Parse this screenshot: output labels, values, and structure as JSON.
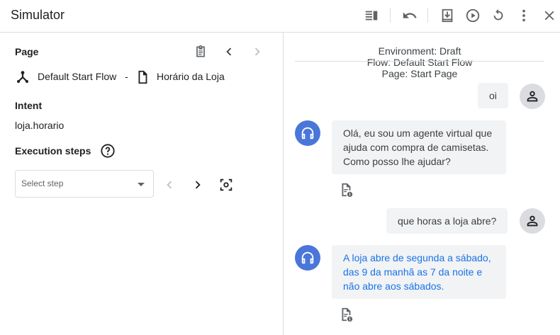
{
  "header": {
    "title": "Simulator",
    "icons": [
      "view-panel-icon",
      "undo-icon",
      "download-icon",
      "play-icon",
      "reset-icon",
      "more-vert-icon",
      "close-icon"
    ]
  },
  "left": {
    "page_label": "Page",
    "flow_name": "Default Start Flow",
    "separator": "-",
    "page_name": "Horário da Loja",
    "intent_label": "Intent",
    "intent_value": "loja.horario",
    "execution_label": "Execution steps",
    "select_placeholder": "Select step"
  },
  "right": {
    "environment": "Environment: Draft",
    "flow": "Flow: Default Start Flow",
    "page": "Page: Start Page",
    "messages": [
      {
        "role": "user",
        "text": "oi"
      },
      {
        "role": "agent",
        "text": "Olá, eu sou um agente virtual que ajuda com compra de camisetas. Como posso lhe ajudar?",
        "color": "#3c4043"
      },
      {
        "role": "user",
        "text": "que horas a loja abre?"
      },
      {
        "role": "agent",
        "text": "A loja abre de segunda a sábado, das 9 da manhã as 7 da noite e não abre aos sábados.",
        "color": "#1a73e8"
      }
    ]
  },
  "colors": {
    "agent_avatar": "#4a76d9",
    "link_blue": "#1a73e8"
  }
}
